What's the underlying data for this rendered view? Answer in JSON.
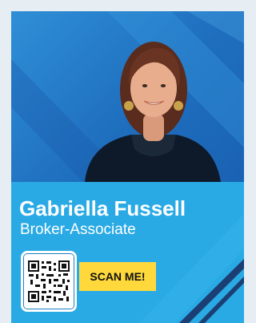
{
  "agent": {
    "name": "Gabriella Fussell",
    "title": "Broker-Associate"
  },
  "cta": {
    "scan_label": "SCAN ME!"
  },
  "colors": {
    "card_blue": "#2aaae5",
    "photo_blue": "#1f6fbf",
    "accent_yellow": "#ffd93b",
    "stripe_navy": "#1b3f73"
  },
  "icons": [
    "qr-code-icon"
  ]
}
